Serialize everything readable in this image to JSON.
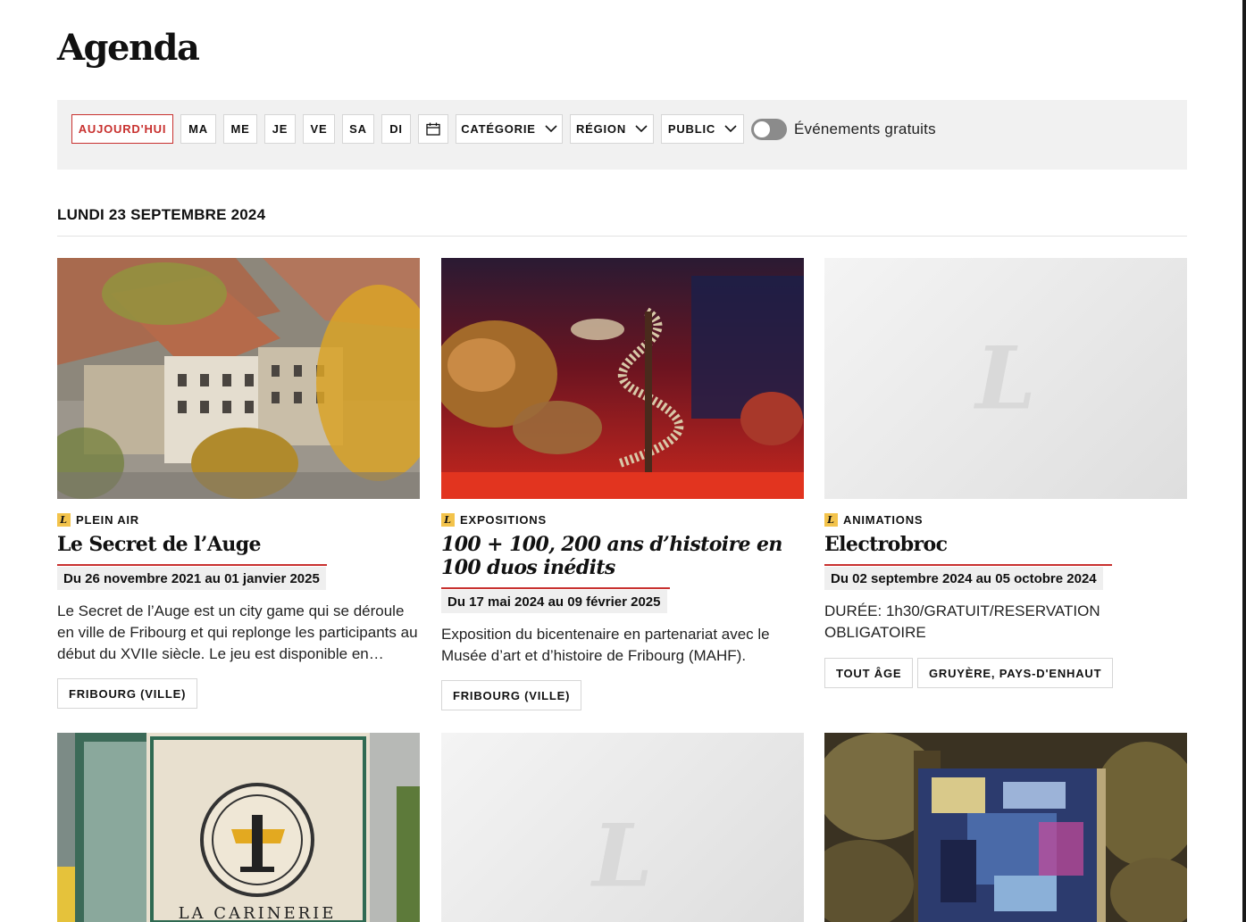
{
  "page": {
    "title": "Agenda"
  },
  "filters": {
    "today": "AUJOURD'HUI",
    "days": [
      "MA",
      "ME",
      "JE",
      "VE",
      "SA",
      "DI"
    ],
    "category": "CATÉGORIE",
    "region": "RÉGION",
    "public": "PUBLIC",
    "free_events_label": "Événements gratuits",
    "free_events_on": false
  },
  "date_heading": "LUNDI 23 SEPTEMBRE 2024",
  "events": [
    {
      "category": "PLEIN AIR",
      "title": "Le Secret de l’Auge",
      "dates": "Du 26 novembre 2021 au 01 janvier 2025",
      "description": "Le Secret de l’Auge est un city game qui se déroule en ville de Fribourg et qui replonge les participants au début du XVIIe siècle. Le jeu est disponible en…",
      "tags": [
        "FRIBOURG (VILLE)"
      ]
    },
    {
      "category": "EXPOSITIONS",
      "title": "100 + 100, 200 ans d’histoire en 100 duos inédits",
      "dates": "Du 17 mai 2024 au 09 février 2025",
      "description": "Exposition du bicentenaire en partenariat avec le Musée d’art et d’histoire de Fribourg (MAHF).",
      "tags": [
        "FRIBOURG (VILLE)"
      ]
    },
    {
      "category": "ANIMATIONS",
      "title": "Electrobroc",
      "dates": "Du 02 septembre 2024 au 05 octobre 2024",
      "description": "DURÉE: 1h30/GRATUIT/RESERVATION OBLIGATOIRE",
      "tags": [
        "TOUT ÂGE",
        "GRUYÈRE, PAYS-D'ENHAUT"
      ]
    }
  ],
  "second_row_sign_text": "LA CARINERIE",
  "logo_letter": "L",
  "colors": {
    "accent": "#c8312f",
    "badge": "#f3c34b",
    "filter_bg": "#f1f1f1"
  }
}
